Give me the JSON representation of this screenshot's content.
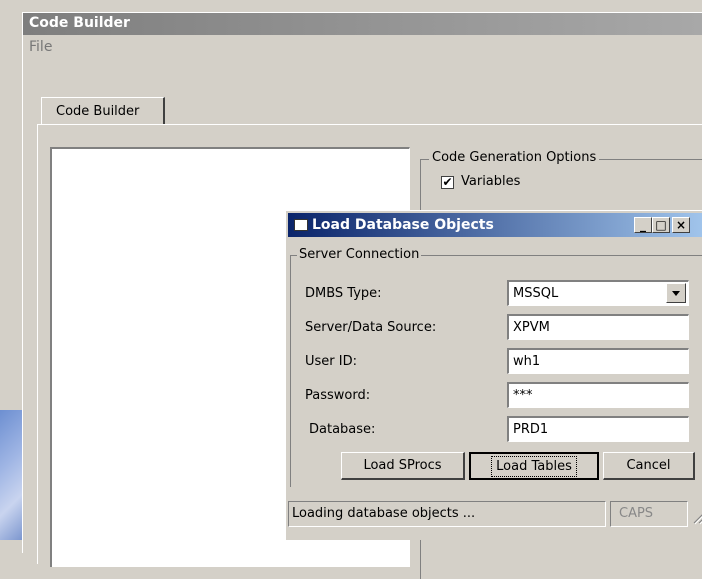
{
  "main_window": {
    "title": "Code Builder",
    "menu": {
      "file": "File"
    },
    "tab": {
      "label": "Code Builder"
    },
    "code_generation_options": {
      "legend": "Code Generation Options",
      "variables": {
        "label": "Variables",
        "checked": true
      }
    }
  },
  "dialog": {
    "title": "Load Database Objects",
    "caption_buttons": {
      "minimize": "_",
      "maximize": "□",
      "close": "×"
    },
    "server_connection": {
      "legend": "Server Connection",
      "fields": [
        {
          "label": "DMBS Type:",
          "value": "MSSQL"
        },
        {
          "label": "Server/Data Source:",
          "value": "XPVM"
        },
        {
          "label": "User ID:",
          "value": "wh1"
        },
        {
          "label": "Password:",
          "value": "***"
        },
        {
          "label": "Database:",
          "value": "PRD1"
        }
      ]
    },
    "buttons": {
      "load_sprocs": "Load SProcs",
      "load_tables": "Load Tables",
      "cancel": "Cancel"
    },
    "status": {
      "text": "Loading database objects ...",
      "caps": "CAPS"
    }
  },
  "icons": {
    "app": "window-app-icon",
    "dropdown": "chevron-down-icon",
    "checkbox": "checkmark-icon",
    "resize": "resize-grip-icon"
  },
  "colors": {
    "active_title_start": "#0a246a",
    "active_title_end": "#a6caf0",
    "inactive_title_start": "#7e7e7e",
    "inactive_title_end": "#a8a8a8",
    "face": "#d4d0c8"
  }
}
